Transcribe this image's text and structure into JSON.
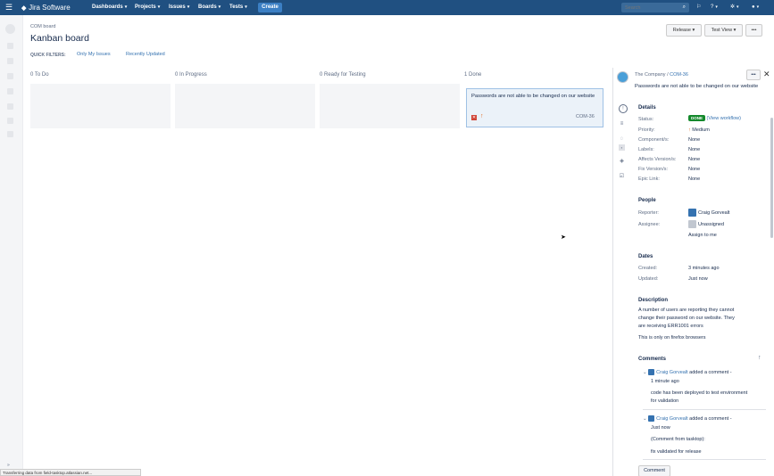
{
  "topnav": {
    "app_name": "Jira Software",
    "menus": [
      "Dashboards",
      "Projects",
      "Issues",
      "Boards",
      "Tests"
    ],
    "create_label": "Create",
    "search_placeholder": "Search"
  },
  "board": {
    "breadcrumb": "COM board",
    "title": "Kanban board",
    "release_label": "Release",
    "view_label": "Test View",
    "more_label": "•••",
    "quick_filters_label": "QUICK FILTERS:",
    "quick_filters": [
      "Only My Issues",
      "Recently Updated"
    ],
    "columns": [
      {
        "count": "0",
        "name": "To Do"
      },
      {
        "count": "0",
        "name": "In Progress"
      },
      {
        "count": "0",
        "name": "Ready for Testing"
      },
      {
        "count": "1",
        "name": "Done"
      }
    ],
    "card": {
      "summary": "Passwords are not able to be changed on our website",
      "key": "COM-36"
    }
  },
  "detail": {
    "project": "The Company /",
    "issue_key": "COM-36",
    "summary": "Passwords are not able to be changed on our website",
    "details_heading": "Details",
    "fields": [
      {
        "label": "Status:",
        "value": "DONE",
        "extra": "(View workflow)"
      },
      {
        "label": "Priority:",
        "value": "Medium"
      },
      {
        "label": "Component/s:",
        "value": "None"
      },
      {
        "label": "Labels:",
        "value": "None"
      },
      {
        "label": "Affects Version/s:",
        "value": "None"
      },
      {
        "label": "Fix Version/s:",
        "value": "None"
      },
      {
        "label": "Epic Link:",
        "value": "None"
      }
    ],
    "people_heading": "People",
    "reporter_label": "Reporter:",
    "reporter": "Craig Gorvealt",
    "assignee_label": "Assignee:",
    "assignee": "Unassigned",
    "assign_to_me": "Assign to me",
    "dates_heading": "Dates",
    "created_label": "Created:",
    "created": "3 minutes ago",
    "updated_label": "Updated:",
    "updated": "Just now",
    "description_heading": "Description",
    "description_lines": [
      "A number of users are reporting they cannot",
      "change their password on our website. They",
      "are receiving ERR1001 errors"
    ],
    "description_extra": "This is only on firefox browsers",
    "comments_heading": "Comments",
    "comments": [
      {
        "author": "Craig Gorvealt",
        "action": "added a comment -",
        "time": "1 minute ago",
        "body": [
          "code has been deployed to test environment",
          "for validation"
        ]
      },
      {
        "author": "Craig Gorvealt",
        "action": "added a comment -",
        "time": "Just now",
        "body": [
          "(Comment from tasktop):",
          "fix validated for release"
        ]
      }
    ],
    "comment_button": "Comment"
  },
  "statusbar": {
    "text": "Transferring data from field-tasktop.atlassian.net..."
  },
  "colors": {
    "nav_bg": "#205081",
    "create_bg": "#3b7fc4",
    "done_badge": "#14892c",
    "link": "#3572b0",
    "priority": "#e06c1f"
  }
}
